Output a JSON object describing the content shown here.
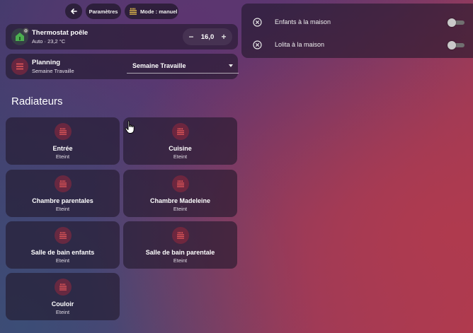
{
  "topbar": {
    "back_icon": "arrow-left-icon",
    "settings_label": "Paramètres",
    "mode_icon": "radiator-icon",
    "mode_label": "Mode : manuel"
  },
  "thermostat": {
    "icon": "home-thermometer-icon",
    "title": "Thermostat poêle",
    "status": "Auto · 23,2 °C",
    "target": "16,0",
    "minus": "−",
    "plus": "+"
  },
  "planning": {
    "icon": "list-icon",
    "title": "Planning",
    "status": "Semaine Travaille",
    "selected": "Semaine Travaille"
  },
  "section_title": "Radiateurs",
  "radiators": [
    {
      "name": "Entrée",
      "state": "Eteint"
    },
    {
      "name": "Cuisine",
      "state": "Eteint"
    },
    {
      "name": "Chambre parentales",
      "state": "Eteint"
    },
    {
      "name": "Chambre Madeleine",
      "state": "Eteint"
    },
    {
      "name": "Salle de bain enfants",
      "state": "Eteint"
    },
    {
      "name": "Salle de bain parentale",
      "state": "Eteint"
    },
    {
      "name": "Couloir",
      "state": "Eteint"
    }
  ],
  "presence": [
    {
      "label": "Enfants à la maison",
      "icon": "close-circle-icon",
      "on": false
    },
    {
      "label": "Lolita à la maison",
      "icon": "close-circle-icon",
      "on": false
    }
  ],
  "colors": {
    "heater_icon": "#e85a5a",
    "thermostat_icon": "#4caf50",
    "planning_icon": "#e85a5a"
  }
}
